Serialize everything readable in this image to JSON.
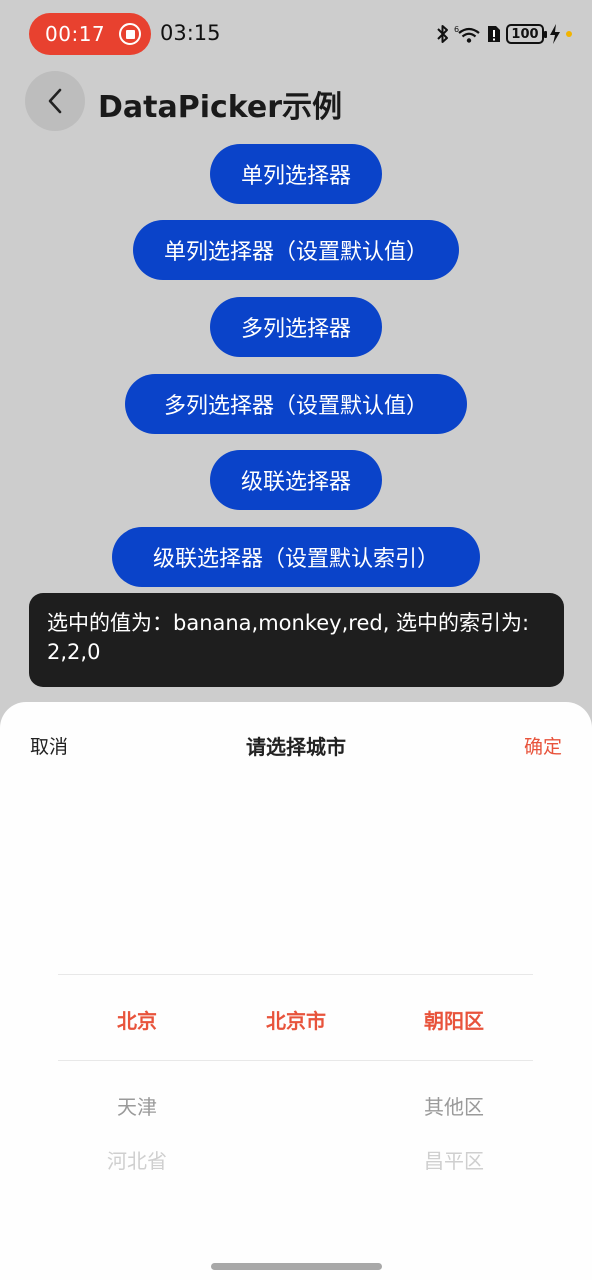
{
  "status_bar": {
    "recording_time": "00:17",
    "clock": "03:15",
    "battery": "100",
    "icons": [
      "bluetooth-icon",
      "wifi-6-icon",
      "sim-alert-icon",
      "battery-icon",
      "charging-bolt-icon"
    ]
  },
  "header": {
    "title": "DataPicker示例"
  },
  "buttons": [
    "单列选择器",
    "单列选择器（设置默认值）",
    "多列选择器",
    "多列选择器（设置默认值）",
    "级联选择器",
    "级联选择器（设置默认索引）"
  ],
  "toast": {
    "text": "选中的值为：banana,monkey,red, 选中的索引为: 2,2,0"
  },
  "picker": {
    "cancel_label": "取消",
    "title": "请选择城市",
    "confirm_label": "确定",
    "columns": [
      {
        "selected": "北京",
        "below": [
          "天津",
          "河北省"
        ]
      },
      {
        "selected": "北京市",
        "below": []
      },
      {
        "selected": "朝阳区",
        "below": [
          "其他区",
          "昌平区"
        ]
      }
    ]
  },
  "colors": {
    "accent": "#e8533b",
    "button_blue": "#0a43c9",
    "record_red": "#e8412f"
  }
}
